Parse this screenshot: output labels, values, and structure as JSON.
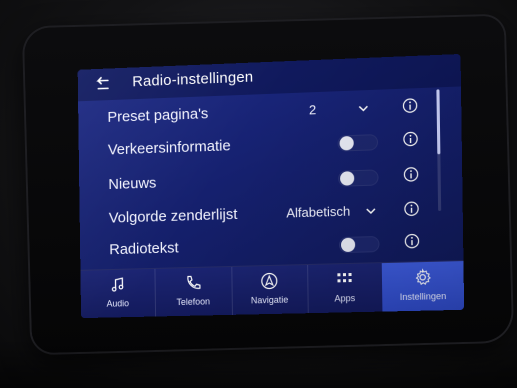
{
  "header": {
    "title": "Radio-instellingen",
    "back_icon": "back-icon"
  },
  "rows": [
    {
      "label": "Preset pagina's",
      "value": "2",
      "control": "dropdown"
    },
    {
      "label": "Verkeersinformatie",
      "control": "toggle",
      "on": false
    },
    {
      "label": "Nieuws",
      "control": "toggle",
      "on": false
    },
    {
      "label": "Volgorde zenderlijst",
      "value": "Alfabetisch",
      "control": "dropdown"
    },
    {
      "label": "Radiotekst",
      "control": "toggle",
      "on": false
    }
  ],
  "tabs": [
    {
      "label": "Audio",
      "icon": "music-note-icon"
    },
    {
      "label": "Telefoon",
      "icon": "phone-icon"
    },
    {
      "label": "Navigatie",
      "icon": "navigation-arrow-icon"
    },
    {
      "label": "Apps",
      "icon": "apps-grid-icon"
    },
    {
      "label": "Instellingen",
      "icon": "settings-gear-icon",
      "active": true
    }
  ],
  "colors": {
    "screen_bg": "#1d2a86",
    "active_tab": "#3d5bdc",
    "text": "#f2f4ff"
  }
}
